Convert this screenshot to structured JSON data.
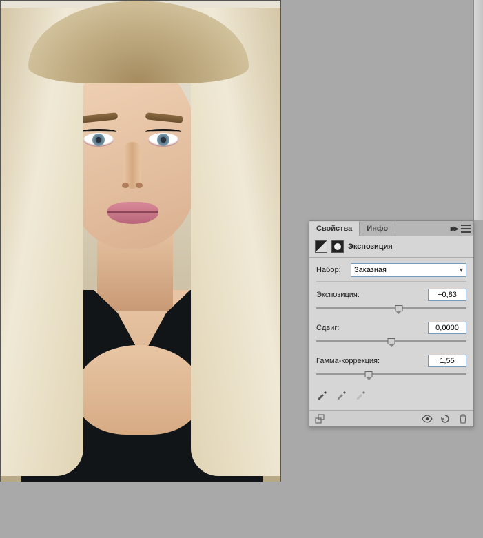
{
  "panel": {
    "tabs": {
      "properties": "Свойства",
      "info": "Инфо"
    },
    "title": "Экспозиция",
    "preset": {
      "label": "Набор:",
      "value": "Заказная"
    },
    "controls": {
      "exposure": {
        "label": "Экспозиция:",
        "value": "+0,83",
        "pos": 55
      },
      "offset": {
        "label": "Сдвиг:",
        "value": "0,0000",
        "pos": 50
      },
      "gamma": {
        "label": "Гамма-коррекция:",
        "value": "1,55",
        "pos": 35
      }
    }
  }
}
